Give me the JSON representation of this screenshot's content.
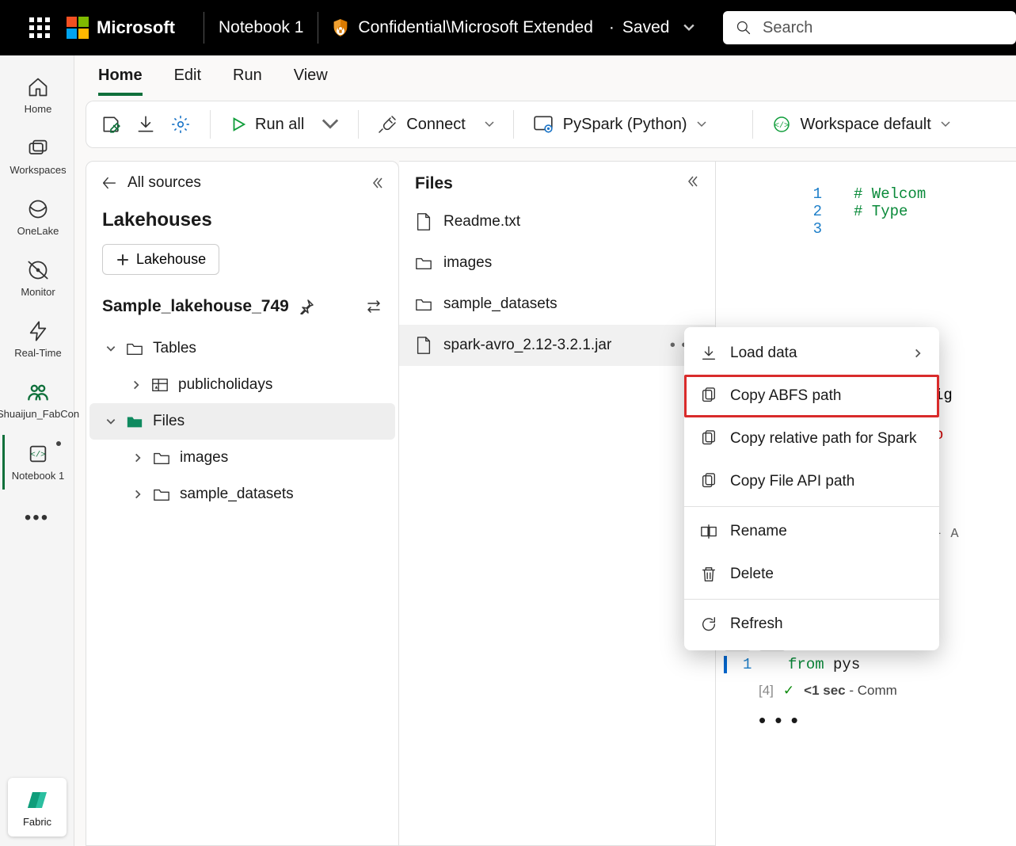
{
  "topbar": {
    "brand": "Microsoft",
    "notebook_title": "Notebook 1",
    "sensitivity": "Confidential\\Microsoft Extended",
    "saved_dot": "·",
    "saved_text": "Saved",
    "search_placeholder": "Search"
  },
  "rail": {
    "items": [
      {
        "label": "Home"
      },
      {
        "label": "Workspaces"
      },
      {
        "label": "OneLake"
      },
      {
        "label": "Monitor"
      },
      {
        "label": "Real-Time"
      },
      {
        "label": "Shuaijun_FabCon"
      },
      {
        "label": "Notebook 1"
      }
    ],
    "fabric_label": "Fabric"
  },
  "tabs": [
    "Home",
    "Edit",
    "Run",
    "View"
  ],
  "toolbar": {
    "runall": "Run all",
    "connect": "Connect",
    "pyspark": "PySpark (Python)",
    "env": "Workspace default"
  },
  "sources_panel": {
    "back": "All sources",
    "section_title": "Lakehouses",
    "add_button": "Lakehouse",
    "lakehouse_name": "Sample_lakehouse_749",
    "tree": {
      "tables": "Tables",
      "table1": "publicholidays",
      "files": "Files",
      "folder1": "images",
      "folder2": "sample_datasets"
    }
  },
  "files_panel": {
    "title": "Files",
    "items": [
      {
        "name": "Readme.txt",
        "type": "file"
      },
      {
        "name": "images",
        "type": "folder"
      },
      {
        "name": "sample_datasets",
        "type": "folder"
      },
      {
        "name": "spark-avro_2.12-3.2.1.jar",
        "type": "file"
      }
    ]
  },
  "context_menu": {
    "load_data": "Load data",
    "copy_abfs": "Copy ABFS path",
    "copy_rel": "Copy relative path for Spark",
    "copy_fileapi": "Copy File API path",
    "rename": "Rename",
    "delete": "Delete",
    "refresh": "Refresh"
  },
  "notebook": {
    "cell1": {
      "line1_no": "1",
      "line1_code": "# Welcom",
      "line2_no": "2",
      "line2_code": "# Type ",
      "line3_no": "3"
    },
    "cell2": {
      "count": "[4]",
      "line_no": "1",
      "kw_from": "from",
      "rest": " pys",
      "status_time": "<1 sec",
      "status_text": " - Comm"
    }
  }
}
